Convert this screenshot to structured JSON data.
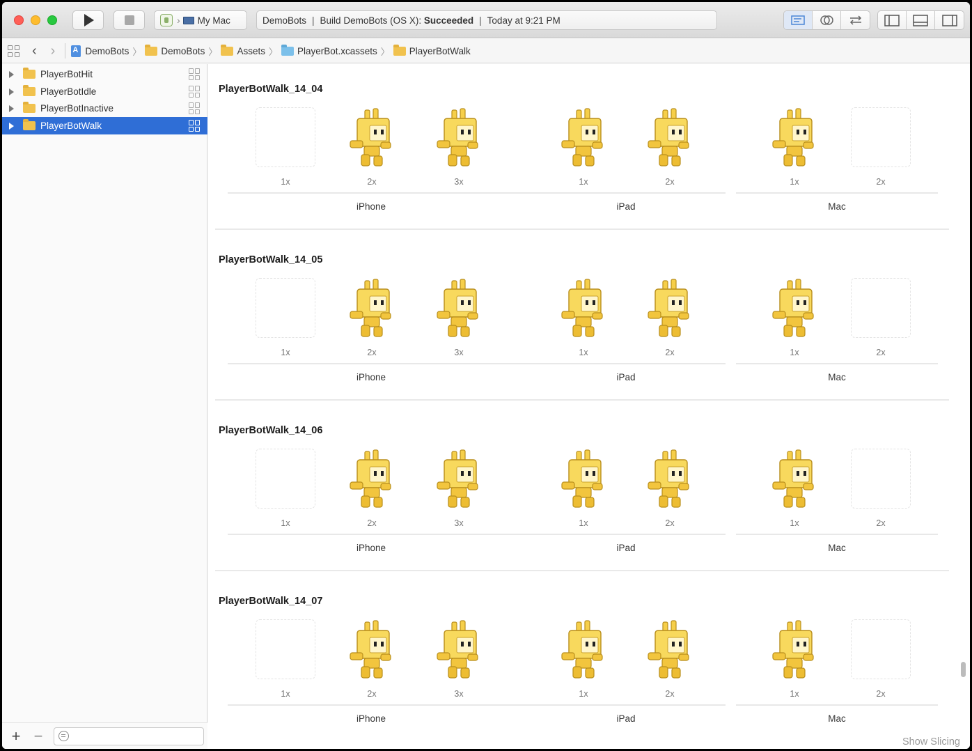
{
  "toolbar": {
    "scheme_target": "My Mac",
    "activity_project": "DemoBots",
    "activity_build": "Build DemoBots (OS X):",
    "activity_status": "Succeeded",
    "activity_time": "Today at 9:21 PM"
  },
  "jumpbar": {
    "crumbs": [
      "DemoBots",
      "DemoBots",
      "Assets",
      "PlayerBot.xcassets",
      "PlayerBotWalk"
    ]
  },
  "navigator": {
    "items": [
      {
        "label": "PlayerBotHit",
        "selected": false
      },
      {
        "label": "PlayerBotIdle",
        "selected": false
      },
      {
        "label": "PlayerBotInactive",
        "selected": false
      },
      {
        "label": "PlayerBotWalk",
        "selected": true
      }
    ]
  },
  "editor": {
    "sets": [
      {
        "name": "PlayerBotWalk_14_04"
      },
      {
        "name": "PlayerBotWalk_14_05"
      },
      {
        "name": "PlayerBotWalk_14_06"
      },
      {
        "name": "PlayerBotWalk_14_07"
      }
    ],
    "devices": {
      "iphone": "iPhone",
      "ipad": "iPad",
      "mac": "Mac"
    },
    "scales": {
      "s1": "1x",
      "s2": "2x",
      "s3": "3x"
    },
    "show_slicing": "Show Slicing"
  },
  "colors": {
    "selection": "#2f6ed6",
    "folder": "#f1c24e",
    "bot_body": "#f6cf4a"
  }
}
